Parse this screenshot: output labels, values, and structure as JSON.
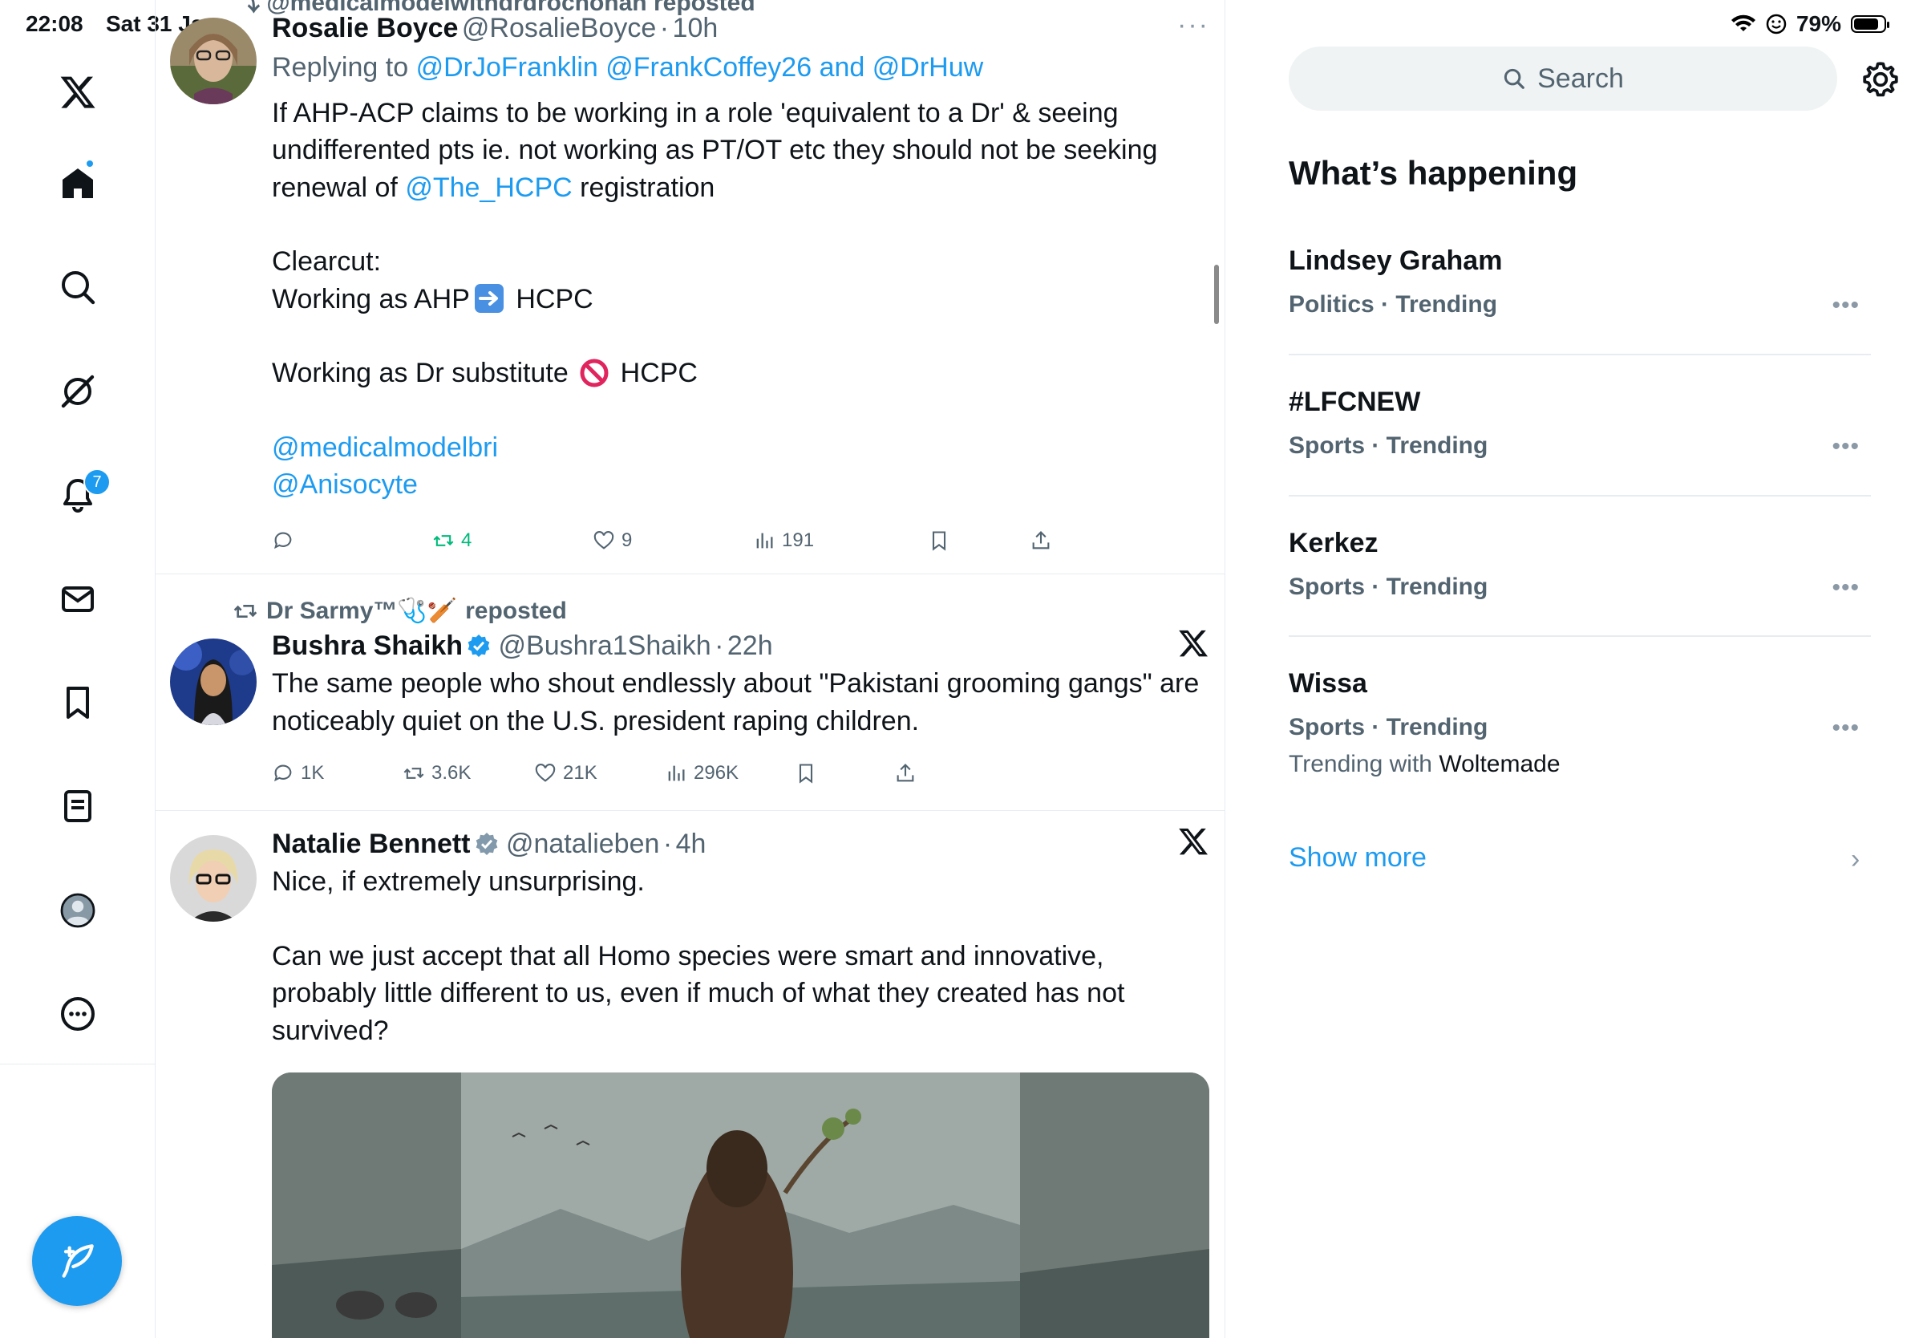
{
  "status_bar": {
    "time": "22:08",
    "date": "Sat 31 Jan",
    "battery": "79%"
  },
  "nav": {
    "notifications_badge": "7"
  },
  "tweets": [
    {
      "name": "Rosalie Boyce",
      "handle": "@RosalieBoyce",
      "sep": "·",
      "time": "10h",
      "replying_prefix": "Replying to",
      "replying_to": "@DrJoFranklin @FrankCoffey26 and @DrHuw",
      "line1": "If AHP-ACP claims to be working in a role 'equivalent to a Dr' & seeing",
      "line2": "undifferented pts ie. not working as PT/OT etc they should not be seeking",
      "line3_pre": "renewal of",
      "line3_link": "@The_HCPC",
      "line3_post": "registration",
      "line4": "Clearcut:",
      "line5_pre": "Working as AHP",
      "line5_post": "HCPC",
      "line6_pre": "Working as Dr substitute",
      "line6_post": "HCPC",
      "mention1": "@medicalmodelbri",
      "mention2": "@Anisocyte",
      "reposts": "4",
      "likes": "9",
      "views": "191"
    },
    {
      "reposter": "Dr Sarmy™🩺🏏",
      "reposted_label": "reposted",
      "name": "Bushra Shaikh",
      "handle": "@Bushra1Shaikh",
      "sep": "·",
      "time": "22h",
      "line1": "The same people who shout endlessly about \"Pakistani grooming gangs\" are",
      "line2": "noticeably quiet on the U.S. president raping children.",
      "replies": "1K",
      "reposts": "3.6K",
      "likes": "21K",
      "views": "296K"
    },
    {
      "name": "Natalie Bennett",
      "handle": "@natalieben",
      "sep": "·",
      "time": "4h",
      "line1": "Nice, if extremely unsurprising.",
      "line2": "Can we just accept that all Homo species were smart and innovative,",
      "line3": "probably little different to us, even if much of what they created has not",
      "line4": "survived?"
    }
  ],
  "search": {
    "placeholder": "Search"
  },
  "whats_happening": {
    "title": "What’s happening",
    "trends": [
      {
        "name": "Lindsey Graham",
        "meta": "Politics · Trending"
      },
      {
        "name": "#LFCNEW",
        "meta": "Sports · Trending"
      },
      {
        "name": "Kerkez",
        "meta": "Sports · Trending"
      },
      {
        "name": "Wissa",
        "meta": "Sports · Trending",
        "with_prefix": "Trending with",
        "with_name": "Woltemade"
      }
    ],
    "show_more": "Show more"
  },
  "colors": {
    "accent": "#1d9bf0",
    "repost_green": "#00ba7c",
    "muted": "#536471"
  }
}
